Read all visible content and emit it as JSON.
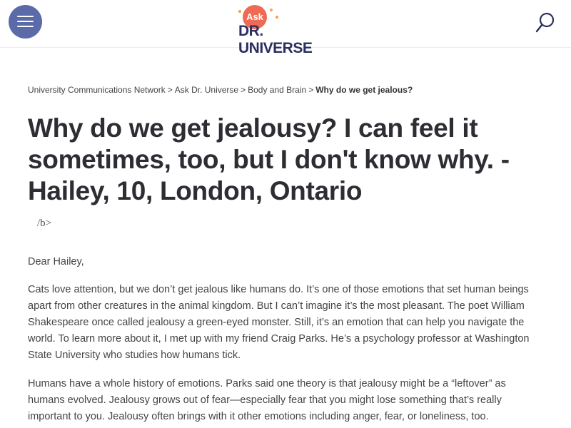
{
  "header": {
    "menu_icon": "hamburger-menu-icon",
    "logo": {
      "ask": "Ask",
      "brand": "DR. UNIVERSE",
      "accent_color": "#ef6a55",
      "text_color": "#2b2f5f"
    },
    "search_icon": "search-icon",
    "menu_color": "#5b6aa8"
  },
  "breadcrumb": {
    "items": [
      "University Communications Network",
      "Ask Dr. Universe",
      "Body and Brain"
    ],
    "separator": ">",
    "current": "Why do we get jealous?"
  },
  "article": {
    "title": "Why do we get jealousy? I can feel it sometimes, too, but I don't know why.  -Hailey, 10, London, Ontario",
    "stray_markup": "/b>",
    "greeting": "Dear Hailey,",
    "paragraphs": [
      "Cats love attention, but we don’t get jealous like humans do. It’s one of those emotions that set human beings apart from other creatures in the animal kingdom. But I can’t imagine it’s the most pleasant. The poet William Shakespeare once called jealousy a green-eyed monster. Still, it’s an emotion that can help you navigate the world.  To learn more about it, I met up with my friend Craig Parks. He’s a psychology professor at Washington State University who studies how humans tick.",
      "Humans have a whole history of emotions. Parks said one theory is that jealousy might be a “leftover” as humans evolved. Jealousy grows out of fear—especially fear that you might lose something that’s really important to you. Jealousy often brings with it other emotions including anger, fear, or loneliness, too."
    ]
  }
}
